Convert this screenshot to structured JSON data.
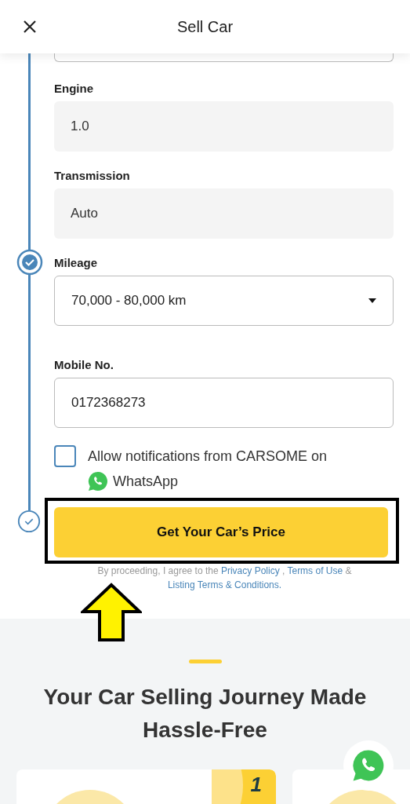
{
  "header": {
    "title": "Sell Car"
  },
  "fields": [
    {
      "label": "Engine",
      "value": "1.0",
      "kind": "readonly"
    },
    {
      "label": "Transmission",
      "value": "Auto",
      "kind": "readonly"
    },
    {
      "label": "Mileage",
      "value": "70,000 - 80,000 km",
      "kind": "select",
      "step": {
        "done": true
      }
    },
    {
      "label": "Mobile No.",
      "value": "0172368273",
      "kind": "input"
    }
  ],
  "consent": {
    "label": "Allow notifications from CARSOME on",
    "channel": "WhatsApp",
    "checked": false
  },
  "submit": {
    "label": "Get Your Car’s Price",
    "step": {
      "done": false
    },
    "highlighted": true
  },
  "disclaimer": [
    {
      "text": "By proceeding, I agree to the",
      "link": false
    },
    {
      "text": "Privacy Policy",
      "link": true
    },
    {
      "text": ",",
      "link": false
    },
    {
      "text": "Terms of Use",
      "link": true
    },
    {
      "text": "&",
      "link": false
    },
    {
      "text": "Listing Terms & Conditions.",
      "link": true
    }
  ],
  "journey": {
    "title": "Your Car Selling Journey Made Hassle-Free",
    "badge": "1"
  }
}
